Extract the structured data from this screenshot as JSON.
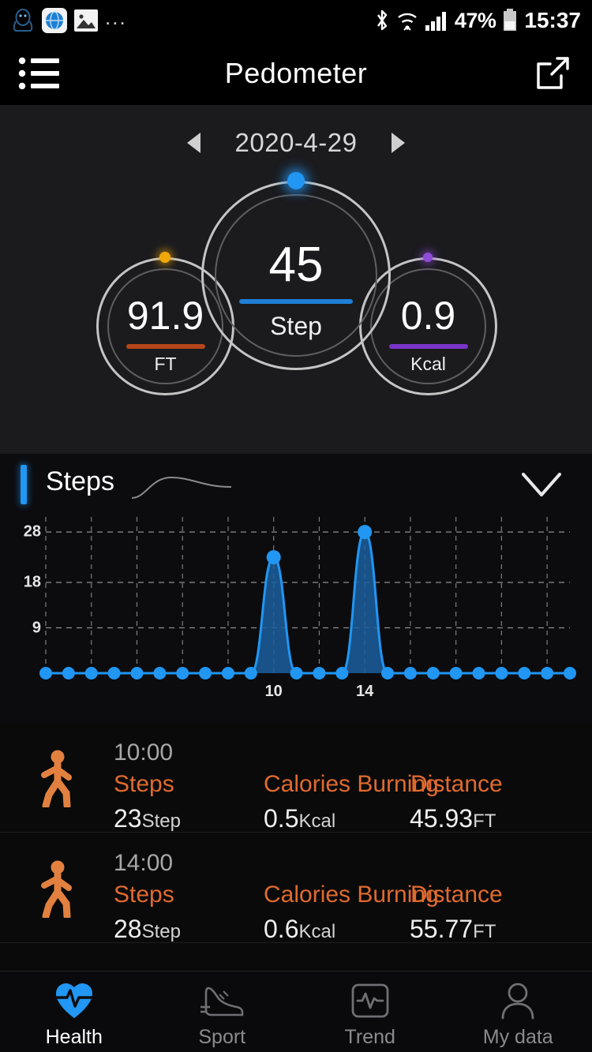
{
  "status_bar": {
    "left_icons": [
      "qq-penguin-icon",
      "browser-globe-icon",
      "gallery-image-icon",
      "more-dots-icon"
    ],
    "more_dots": "...",
    "bluetooth_icon": "bluetooth-icon",
    "wifi_icon": "wifi-icon",
    "signal_icon": "signal-bars-icon",
    "battery_percent": "47%",
    "battery_icon": "battery-icon",
    "time": "15:37"
  },
  "title_bar": {
    "menu_icon": "list-menu-icon",
    "title": "Pedometer",
    "share_icon": "share-external-icon"
  },
  "date_nav": {
    "prev_icon": "chevron-left-icon",
    "date": "2020-4-29",
    "next_icon": "chevron-right-icon"
  },
  "gauges": {
    "step": {
      "value": "45",
      "label": "Step",
      "accent": "#1e7fd6",
      "dot": "#2196f3"
    },
    "distance": {
      "value": "91.9",
      "label": "FT",
      "accent": "#b5461a",
      "dot": "#f0a808"
    },
    "calories": {
      "value": "0.9",
      "label": "Kcal",
      "accent": "#7b34c9",
      "dot": "#8f4cd8"
    }
  },
  "steps_section": {
    "title": "Steps",
    "accent_color": "#2196f3",
    "collapse_icon": "chevron-down-icon"
  },
  "chart_data": {
    "type": "area",
    "title": "Steps",
    "xlabel": "",
    "ylabel": "",
    "grid": true,
    "legend": false,
    "ylim": [
      0,
      31
    ],
    "yticks": [
      9,
      18,
      28
    ],
    "ytick_labels": [
      "9",
      "18",
      "28"
    ],
    "x": [
      0,
      1,
      2,
      3,
      4,
      5,
      6,
      7,
      8,
      9,
      10,
      11,
      12,
      13,
      14,
      15,
      16,
      17,
      18,
      19,
      20,
      21,
      22,
      23
    ],
    "xtick_labels": [
      "10",
      "14"
    ],
    "xticks": [
      10,
      14
    ],
    "values": [
      0,
      0,
      0,
      0,
      0,
      0,
      0,
      0,
      0,
      0,
      23,
      0,
      0,
      0,
      28,
      0,
      0,
      0,
      0,
      0,
      0,
      0,
      0,
      0
    ],
    "series_color": "#2196f3",
    "fill_color": "#1b5f9e"
  },
  "activities": {
    "headers": {
      "steps": "Steps",
      "calories": "Calories Burning",
      "distance": "Distance"
    },
    "items": [
      {
        "icon": "walking-person-icon",
        "time": "10:00",
        "steps_value": "23",
        "steps_unit": "Step",
        "calories_value": "0.5",
        "calories_unit": "Kcal",
        "distance_value": "45.93",
        "distance_unit": "FT"
      },
      {
        "icon": "walking-person-icon",
        "time": "14:00",
        "steps_value": "28",
        "steps_unit": "Step",
        "calories_value": "0.6",
        "calories_unit": "Kcal",
        "distance_value": "55.77",
        "distance_unit": "FT"
      }
    ]
  },
  "bottom_nav": {
    "active_color": "#2196f3",
    "items": [
      {
        "label": "Health",
        "icon": "heart-pulse-icon",
        "active": true
      },
      {
        "label": "Sport",
        "icon": "running-shoe-icon",
        "active": false
      },
      {
        "label": "Trend",
        "icon": "trend-pulse-square-icon",
        "active": false
      },
      {
        "label": "My data",
        "icon": "person-profile-icon",
        "active": false
      }
    ]
  }
}
